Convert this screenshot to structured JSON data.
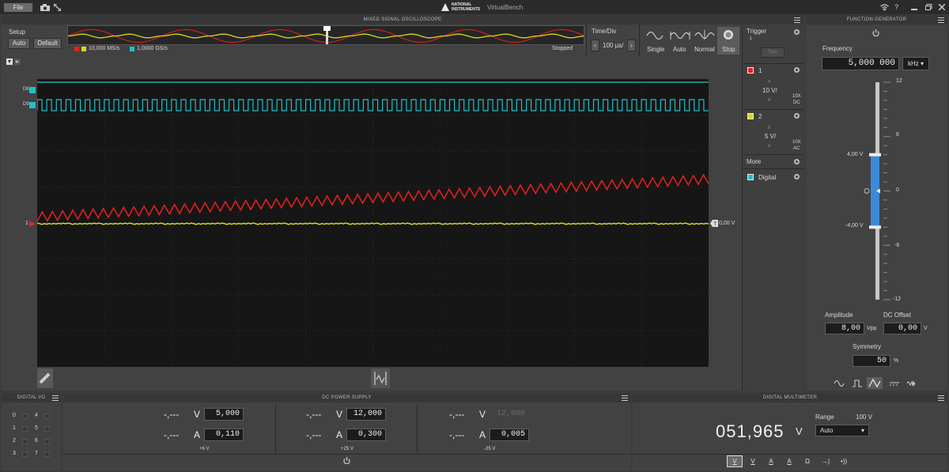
{
  "titlebar": {
    "file_label": "File",
    "app_title": "VirtualBench",
    "brand_line1": "NATIONAL",
    "brand_line2": "INSTRUMENTS"
  },
  "scope": {
    "title": "MIXED SIGNAL OSCILLOSCOPE",
    "setup_label": "Setup",
    "auto_label": "Auto",
    "default_label": "Default",
    "analog_rate": "10,000 MS/s",
    "digital_rate": "1,0000 GS/s",
    "status": "Stopped",
    "timediv_label": "Time/Div",
    "timediv_value": "100 µs/",
    "modes": [
      {
        "label": "Single",
        "icon": "single-sweep-icon"
      },
      {
        "label": "Auto",
        "icon": "auto-sweep-icon"
      },
      {
        "label": "Normal",
        "icon": "normal-sweep-icon"
      },
      {
        "label": "Stop",
        "icon": "stop-icon"
      }
    ],
    "digital_rows": [
      {
        "label": "D6"
      },
      {
        "label": "D9"
      }
    ],
    "ch1_marker": "1",
    "trigger_level": "0,00 V",
    "ch1_color": "#e82020",
    "ch2_color": "#d8d820",
    "digital_color": "#20c0c8"
  },
  "side": {
    "trigger_label": "Trigger",
    "trigger_sub": "1",
    "trigger_btn": "Type",
    "ch1": {
      "name": "1",
      "scale": "10 V/",
      "probe": "10X",
      "coupling": "DC"
    },
    "ch2": {
      "name": "2",
      "scale": "5 V/",
      "probe": "10X",
      "coupling": "AC"
    },
    "more_label": "More",
    "digital_label": "Digital"
  },
  "fgen": {
    "title": "FUNCTION GENERATOR",
    "freq_label": "Frequency",
    "freq_value": "5,000 000",
    "freq_unit": "kHz",
    "ticks": [
      "12",
      "6",
      "0",
      "-6",
      "-12"
    ],
    "high_label": "4,00 V",
    "low_label": "-4,00 V",
    "amp_label": "Amplitude",
    "amp_value": "8,00",
    "amp_unit": "Vpp",
    "offset_label": "DC Offset",
    "offset_value": "0,00",
    "offset_unit": "V",
    "sym_label": "Symmetry",
    "sym_value": "50",
    "sym_unit": "%",
    "waveforms": [
      "sine-wave-icon",
      "square-wave-icon",
      "triangle-wave-icon",
      "dc-wave-icon",
      "noise-wave-icon"
    ]
  },
  "dio": {
    "title": "DIGITAL I/O",
    "pins": [
      "0",
      "1",
      "2",
      "3",
      "4",
      "5",
      "6",
      "7"
    ]
  },
  "power": {
    "title": "DC POWER SUPPLY",
    "channels": [
      {
        "meas_v": "-,---",
        "unit_v": "V",
        "set_v": "5,000",
        "meas_a": "-,---",
        "unit_a": "A",
        "set_a": "0,110",
        "name": "+6 V"
      },
      {
        "meas_v": "-,---",
        "unit_v": "V",
        "set_v": "12,000",
        "meas_a": "-,---",
        "unit_a": "A",
        "set_a": "0,300",
        "name": "+25 V"
      },
      {
        "meas_v": "-,---",
        "unit_v": "V",
        "set_v": "12,000",
        "meas_a": "-,---",
        "unit_a": "A",
        "set_a": "0,005",
        "name": "-25 V"
      }
    ]
  },
  "dmm": {
    "title": "DIGITAL MULTIMETER",
    "reading": "051,965",
    "unit": "V",
    "range_label": "Range",
    "range_value": "100 V",
    "range_select": "Auto",
    "modes": [
      "V",
      "V",
      "A",
      "A",
      "Ω",
      "→|",
      "•))"
    ]
  }
}
